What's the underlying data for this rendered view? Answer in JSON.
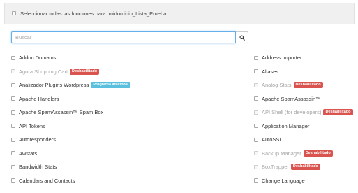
{
  "header": {
    "select_all_label": "Seleccionar todas las funciones para: midominio_Lista_Prueba"
  },
  "search": {
    "placeholder": "Buscar",
    "value": ""
  },
  "colors": {
    "disabled_badge": "#d9534f",
    "premium_badge": "#5bc0de",
    "focus_border": "#66afe9"
  },
  "features": {
    "left": [
      {
        "label": "Addon Domains",
        "disabled": false,
        "badge": ""
      },
      {
        "label": "Agora Shopping Cart",
        "disabled": true,
        "badge": "Deshabilitado"
      },
      {
        "label": "Analizador Plugins Wordpress",
        "disabled": false,
        "badge": "Programa adicional"
      },
      {
        "label": "Apache Handlers",
        "disabled": false,
        "badge": ""
      },
      {
        "label": "Apache SpamAssassin™ Spam Box",
        "disabled": false,
        "badge": ""
      },
      {
        "label": "API Tokens",
        "disabled": false,
        "badge": ""
      },
      {
        "label": "Autoresponders",
        "disabled": false,
        "badge": ""
      },
      {
        "label": "Awstats",
        "disabled": false,
        "badge": ""
      },
      {
        "label": "Bandwidth Stats",
        "disabled": false,
        "badge": ""
      },
      {
        "label": "Calendars and Contacts",
        "disabled": false,
        "badge": ""
      }
    ],
    "right": [
      {
        "label": "Address Importer",
        "disabled": false,
        "badge": ""
      },
      {
        "label": "Aliases",
        "disabled": false,
        "badge": ""
      },
      {
        "label": "Analog Stats",
        "disabled": true,
        "badge": "Deshabilitado"
      },
      {
        "label": "Apache SpamAssassin™",
        "disabled": false,
        "badge": ""
      },
      {
        "label": "API Shell (for developers)",
        "disabled": true,
        "badge": "Deshabilitado"
      },
      {
        "label": "Application Manager",
        "disabled": false,
        "badge": ""
      },
      {
        "label": "AutoSSL",
        "disabled": false,
        "badge": ""
      },
      {
        "label": "Backup Manager",
        "disabled": true,
        "badge": "Deshabilitado"
      },
      {
        "label": "BoxTrapper",
        "disabled": true,
        "badge": "Deshabilitado"
      },
      {
        "label": "Change Language",
        "disabled": false,
        "badge": ""
      }
    ]
  }
}
